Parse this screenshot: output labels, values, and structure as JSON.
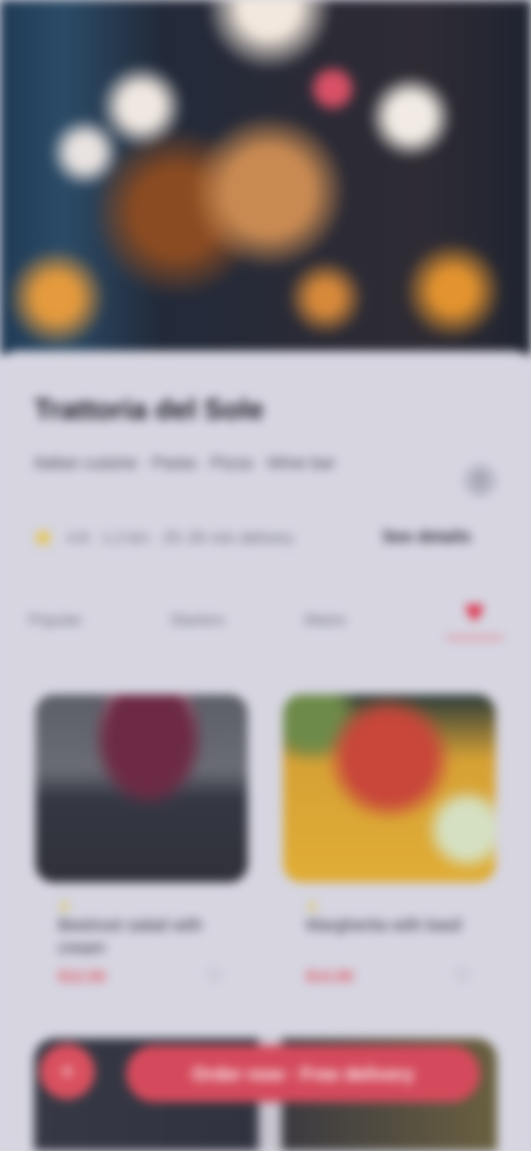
{
  "hero": {
    "image": "restaurant-interior-photo"
  },
  "restaurant": {
    "title": "Trattoria del Sole",
    "subtitle": "Italian cuisine · Pasta · Pizza · Wine bar",
    "rating_text": "4.8 · 1.2 km · 25–35 min delivery",
    "action_label": "See details"
  },
  "icons": {
    "share": "share-icon",
    "star": "star-icon",
    "heart": "heart-icon",
    "plus": "plus-icon"
  },
  "tabs": [
    {
      "label": "Popular"
    },
    {
      "label": "Starters"
    },
    {
      "label": "Mains"
    }
  ],
  "dishes": [
    {
      "name": "Beetroot salad with cream",
      "price": "$12.50"
    },
    {
      "name": "Margherita with basil",
      "price": "$14.90"
    }
  ],
  "banner": {
    "label": "Order now · Free delivery"
  },
  "colors": {
    "accent": "#de2c48",
    "background": "#d6d5e0",
    "star": "#e8c23a"
  }
}
